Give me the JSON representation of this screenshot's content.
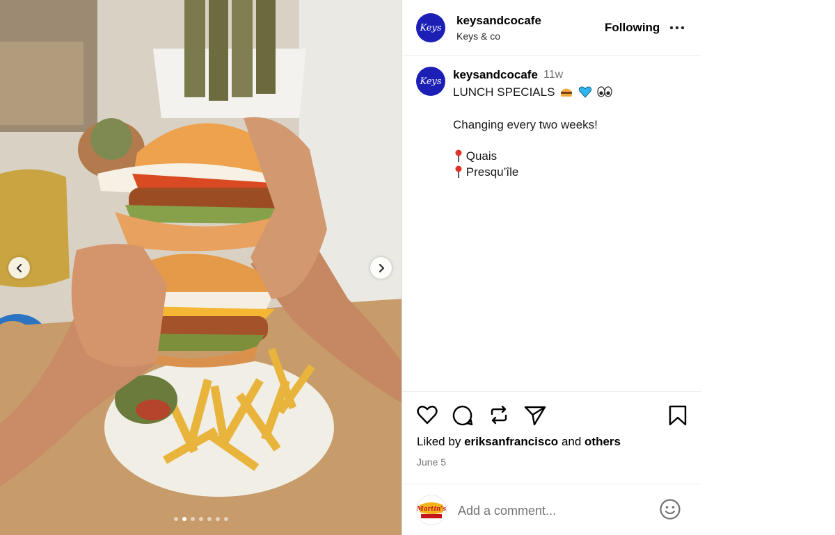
{
  "photo": {
    "carousel": {
      "count": 7,
      "active_index": 1
    },
    "prev_icon": "chevron-left-icon",
    "next_icon": "chevron-right-icon"
  },
  "header": {
    "avatar_text": "Keys",
    "username": "keysandcocafe",
    "subtitle": "Keys & co",
    "follow_label": "Following",
    "more_icon": "more-horizontal-icon"
  },
  "caption": {
    "avatar_text": "Keys",
    "username": "keysandcocafe",
    "time_ago": "11w",
    "title": "LUNCH SPECIALS",
    "title_emojis": [
      "burger-emoji",
      "blue-heart-emoji",
      "eyes-emoji"
    ],
    "line_2": "Changing every two weeks!",
    "locations": [
      "Quais",
      "Presqu’île"
    ],
    "location_icon": "round-pushpin-emoji"
  },
  "actions": {
    "icons": [
      "heart-icon",
      "comment-icon",
      "repost-icon",
      "share-icon",
      "bookmark-icon"
    ]
  },
  "likes": {
    "prefix": "Liked by",
    "user": "eriksanfrancisco",
    "conjunction": "and",
    "others": "others"
  },
  "date": "June 5",
  "comment": {
    "avatar_logo_text": "Martin's",
    "placeholder": "Add a comment...",
    "emoji_icon": "smiley-icon"
  },
  "colors": {
    "brand_avatar": "#1c1fb5",
    "text_secondary": "#737373",
    "divider": "#dbdbdb"
  }
}
